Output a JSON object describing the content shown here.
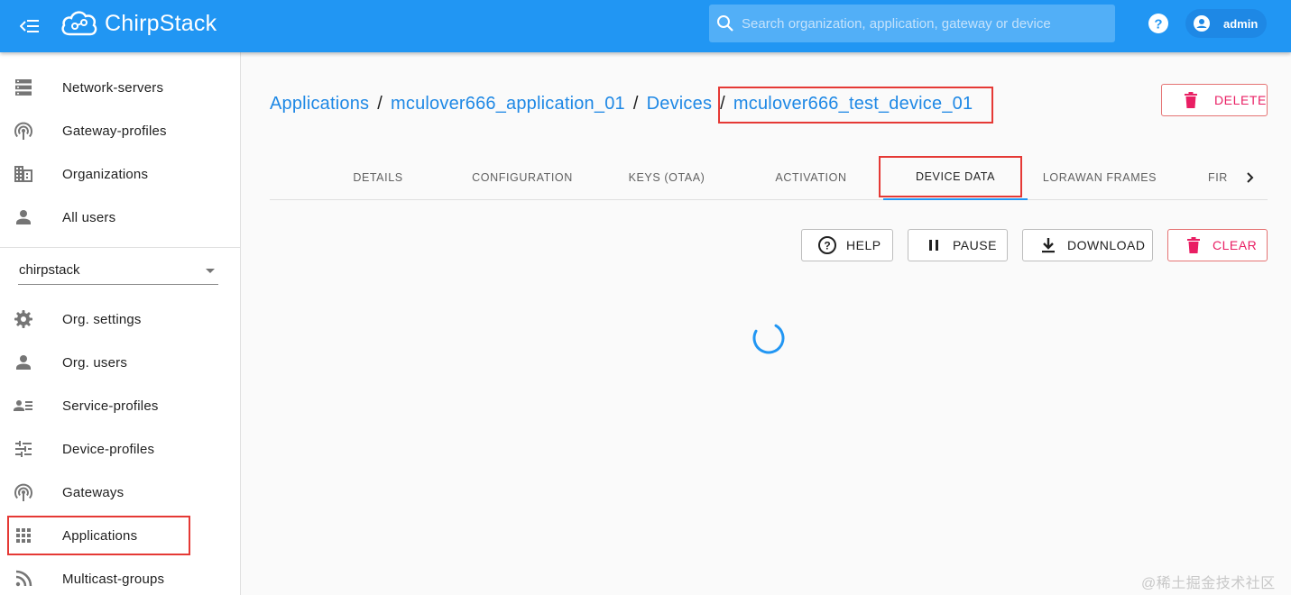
{
  "app": {
    "name": "ChirpStack"
  },
  "topbar": {
    "search_placeholder": "Search organization, application, gateway or device",
    "user_name": "admin"
  },
  "sidebar": {
    "admin_items": [
      {
        "label": "Network-servers",
        "icon": "server-icon"
      },
      {
        "label": "Gateway-profiles",
        "icon": "gateway-icon"
      },
      {
        "label": "Organizations",
        "icon": "domain-icon"
      },
      {
        "label": "All users",
        "icon": "person-icon"
      }
    ],
    "org_select": {
      "selected": "chirpstack"
    },
    "org_items": [
      {
        "label": "Org. settings",
        "icon": "gear-icon"
      },
      {
        "label": "Org. users",
        "icon": "person-icon"
      },
      {
        "label": "Service-profiles",
        "icon": "account-details-icon"
      },
      {
        "label": "Device-profiles",
        "icon": "tune-icon"
      },
      {
        "label": "Gateways",
        "icon": "gateway-icon"
      },
      {
        "label": "Applications",
        "icon": "apps-grid-icon"
      },
      {
        "label": "Multicast-groups",
        "icon": "rss-icon"
      }
    ]
  },
  "breadcrumb": {
    "items": [
      "Applications",
      "mculover666_application_01",
      "Devices",
      "mculover666_test_device_01"
    ],
    "separator": "/"
  },
  "header": {
    "delete_label": "DELETE"
  },
  "tabs": {
    "items": [
      "DETAILS",
      "CONFIGURATION",
      "KEYS (OTAA)",
      "ACTIVATION",
      "DEVICE DATA",
      "LORAWAN FRAMES",
      "FIR"
    ],
    "active": "DEVICE DATA"
  },
  "toolbar": {
    "help_label": "HELP",
    "pause_label": "PAUSE",
    "download_label": "DOWNLOAD",
    "clear_label": "CLEAR"
  },
  "colors": {
    "primary": "#2196f3",
    "link": "#1e88e5",
    "danger": "#e91e63",
    "annotation": "#e53935"
  },
  "watermark": "@稀土掘金技术社区"
}
